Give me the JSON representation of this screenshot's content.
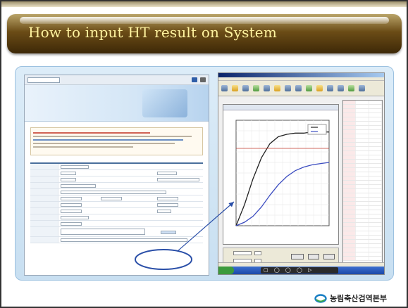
{
  "slide": {
    "title": "How to input HT result on System"
  },
  "form_screenshot": {
    "colors": {
      "header": "#2f5ea8",
      "notice_border": "#d8c7a3",
      "accent_red": "#c43c2e"
    },
    "banner_icon": "laptop-illustration"
  },
  "program_screenshot": {
    "colors": {
      "titlebar": "#0a246a",
      "series_black": "#222222",
      "series_blue": "#3b4cc0",
      "series_red": "#c0392b"
    },
    "tray_glyphs": "▢ ◯ ◯ ◯ ▷",
    "chart_data": {
      "type": "line",
      "series": [
        {
          "values": [
            0,
            18,
            40,
            58,
            70,
            76,
            78,
            79,
            79,
            80,
            80,
            80
          ]
        },
        {
          "values": [
            0,
            3,
            8,
            16,
            26,
            35,
            42,
            47,
            50,
            52,
            53,
            54
          ]
        },
        {
          "values": [
            66,
            66,
            66,
            66,
            66,
            66,
            66,
            66,
            66,
            66,
            66,
            66
          ]
        }
      ],
      "ylim": [
        0,
        90
      ],
      "grid": true
    }
  },
  "footer": {
    "logo_text": "농림축산검역본부",
    "logo_icon": "ring-logo"
  }
}
